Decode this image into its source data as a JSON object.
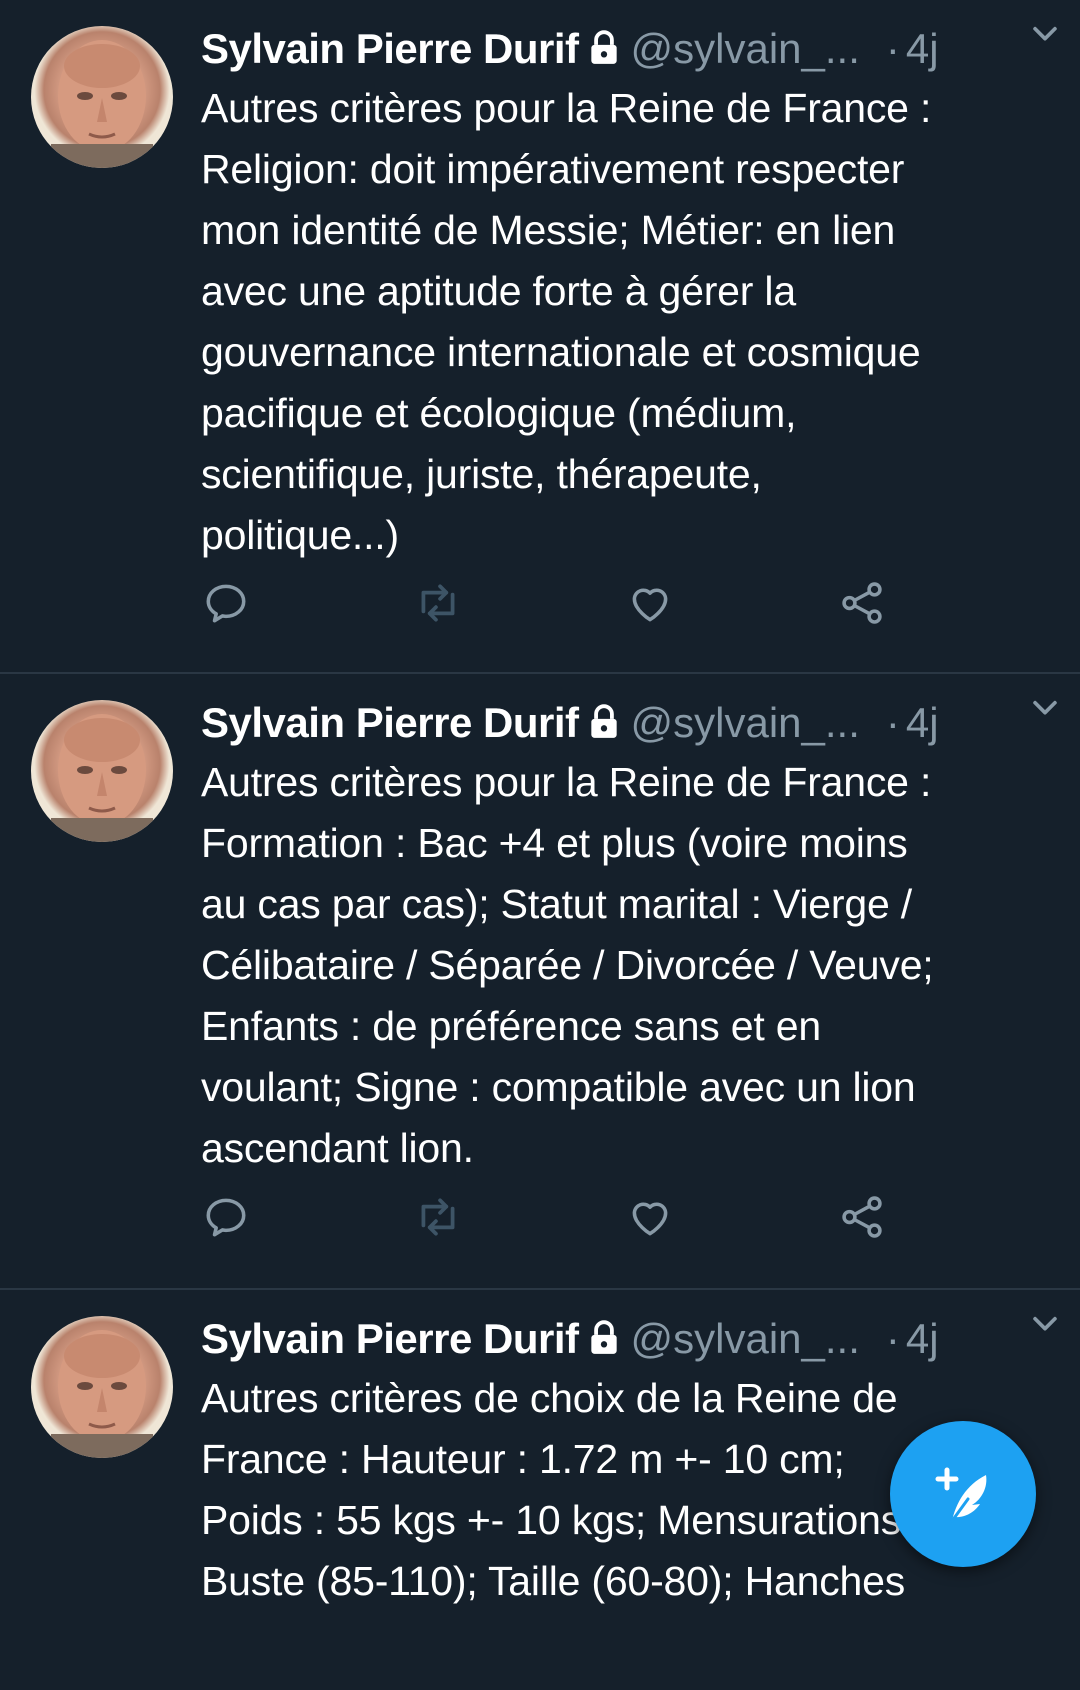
{
  "colors": {
    "background": "#15202b",
    "divider": "#2a3744",
    "text_primary": "#ffffff",
    "text_secondary": "#8899a6",
    "accent": "#1da1f2"
  },
  "icons": {
    "tweet_actions": [
      "reply-icon",
      "retweet-icon",
      "like-icon",
      "share-icon"
    ],
    "header": [
      "lock-icon",
      "chevron-down-icon"
    ],
    "fab": "compose-tweet-icon"
  },
  "tweets": [
    {
      "author_name": "Sylvain Pierre Durif",
      "handle": "@sylvain_...",
      "separator": "·",
      "time": "4j",
      "text": "Autres critères pour la Reine de France :\nReligion: doit impérativement respecter\nmon identité de Messie; Métier: en lien\navec une aptitude forte à gérer la\ngouvernance internationale et cosmique\npacifique et écologique (médium,\nscientifique, juriste, thérapeute,\npolitique...)"
    },
    {
      "author_name": "Sylvain Pierre Durif",
      "handle": "@sylvain_...",
      "separator": "·",
      "time": "4j",
      "text": "Autres critères pour la Reine de France :\nFormation : Bac +4 et plus (voire moins\nau cas par cas); Statut marital : Vierge /\nCélibataire / Séparée / Divorcée / Veuve;\nEnfants : de préférence sans et en\nvoulant; Signe : compatible avec un lion\nascendant lion."
    },
    {
      "author_name": "Sylvain Pierre Durif",
      "handle": "@sylvain_...",
      "separator": "·",
      "time": "4j",
      "text": "Autres critères de choix de la Reine de\nFrance : Hauteur : 1.72 m +- 10 cm;\nPoids : 55 kgs +- 10 kgs; Mensurations :\nBuste (85-110); Taille (60-80); Hanches"
    }
  ]
}
